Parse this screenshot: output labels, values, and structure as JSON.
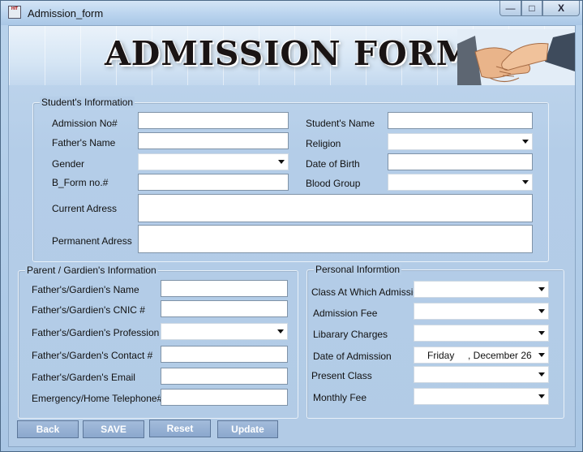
{
  "window": {
    "title": "Admission_form",
    "icon_text": "HIT",
    "buttons": {
      "minimize": "—",
      "maximize": "□",
      "close": "X"
    }
  },
  "banner": {
    "title": "ADMISSION FORM",
    "image": "handshake-image"
  },
  "student_info": {
    "legend": "Student's Information",
    "labels": {
      "admission_no": "Admission No#",
      "students_name": "Student's Name",
      "fathers_name": "Father's Name",
      "religion": "Religion",
      "gender": "Gender",
      "date_of_birth": "Date of Birth",
      "b_form_no": "B_Form no.#",
      "blood_group": "Blood Group",
      "current_address": "Current Adress",
      "permanent_address": "Permanent Adress"
    },
    "values": {
      "admission_no": "",
      "students_name": "",
      "fathers_name": "",
      "religion": "",
      "gender": "",
      "date_of_birth": "",
      "b_form_no": "",
      "blood_group": "",
      "current_address": "",
      "permanent_address": ""
    }
  },
  "parent_info": {
    "legend": "Parent / Gardien's Information",
    "labels": {
      "name": "Father's/Gardien's Name",
      "cnic": "Father's/Gardien's CNIC #",
      "profession": "Father's/Gardien's Profession",
      "contact": "Father's/Garden's Contact #",
      "email": "Father's/Garden's  Email",
      "emergency": "Emergency/Home Telephone#"
    },
    "values": {
      "name": "",
      "cnic": "",
      "profession": "",
      "contact": "",
      "email": "",
      "emergency": ""
    }
  },
  "personal_info": {
    "legend": "Personal Informtion",
    "labels": {
      "class_at_admission": "Class At Which Admission",
      "admission_fee": "Admission Fee",
      "library_charges": "Libarary Charges",
      "date_of_admission": "Date of Admission",
      "present_class": "Present Class",
      "monthly_fee": "Monthly Fee"
    },
    "values": {
      "class_at_admission": "",
      "admission_fee": "",
      "library_charges": "",
      "date_of_admission_day": "Friday",
      "date_of_admission_date": ", December 26",
      "present_class": "",
      "monthly_fee": ""
    }
  },
  "buttons": {
    "back": "Back",
    "save": "SAVE",
    "reset": "Reset",
    "update": "Update"
  },
  "colors": {
    "background": "#b4cde8",
    "banner": "#d6e6f5",
    "button": "#8ba8cd",
    "button_text": "#ffffff"
  }
}
